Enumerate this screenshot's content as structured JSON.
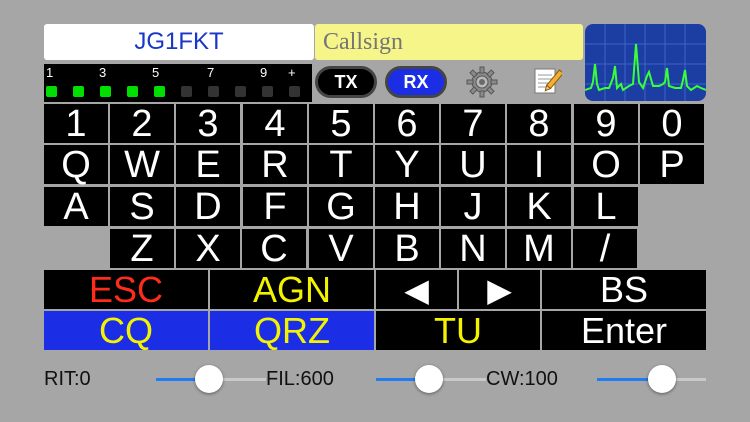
{
  "header": {
    "my_call": "JG1FKT",
    "callsign_placeholder": "Callsign",
    "tx_label": "TX",
    "rx_label": "RX"
  },
  "smeter": {
    "scale_labels": [
      "1",
      "3",
      "5",
      "7",
      "9",
      "+"
    ],
    "active_segments": 5,
    "total_segments": 10,
    "active_color": "#00e000",
    "inactive_color": "#333333"
  },
  "keyboard": {
    "row1": [
      "1",
      "2",
      "3",
      "4",
      "5",
      "6",
      "7",
      "8",
      "9",
      "0"
    ],
    "row2": [
      "Q",
      "W",
      "E",
      "R",
      "T",
      "Y",
      "U",
      "I",
      "O",
      "P"
    ],
    "row3": [
      "A",
      "S",
      "D",
      "F",
      "G",
      "H",
      "J",
      "K",
      "L"
    ],
    "row4": [
      "Z",
      "X",
      "C",
      "V",
      "B",
      "N",
      "M",
      "/"
    ]
  },
  "function_keys": {
    "esc": "ESC",
    "agn": "AGN",
    "left_arrow": "◀",
    "right_arrow": "▶",
    "bs": "BS",
    "cq": "CQ",
    "qrz": "QRZ",
    "tu": "TU",
    "enter": "Enter"
  },
  "colors": {
    "esc_text": "#ff2b1b",
    "yellow_text": "#f3f300",
    "blue_key": "#1b2ee6",
    "accent": "#1f7cf2"
  },
  "sliders": [
    {
      "label": "RIT:0",
      "value": 0.48
    },
    {
      "label": "FIL:600",
      "value": 0.48
    },
    {
      "label": "CW:100",
      "value": 0.6
    }
  ]
}
